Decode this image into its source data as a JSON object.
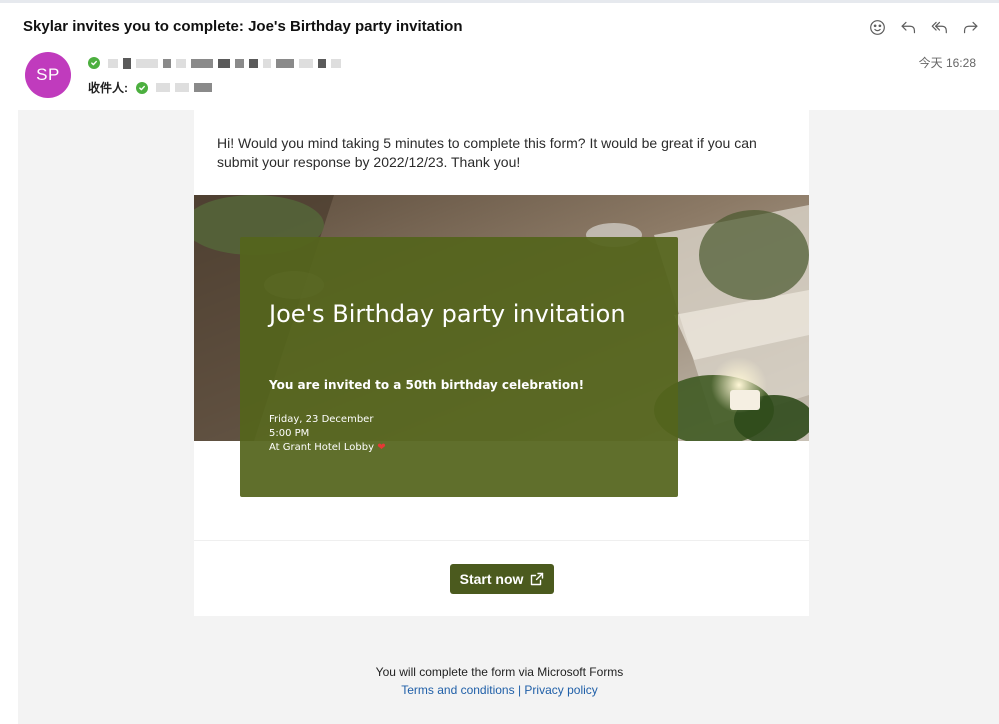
{
  "email": {
    "subject": "Skylar invites you to complete: Joe's Birthday party invitation",
    "avatar_initials": "SP",
    "recipient_label": "收件人:",
    "timestamp": "今天 16:28",
    "toolbar": [
      "emoji-icon",
      "reply-icon",
      "reply-all-icon",
      "forward-icon"
    ]
  },
  "body": {
    "intro": "Hi! Would you mind taking 5 minutes to complete this form? It would be great if you can submit your response by 2022/12/23. Thank you!",
    "invite_title": "Joe's Birthday party invitation",
    "invite_subtitle": "You are invited to a 50th birthday celebration!",
    "date": "Friday, 23 December",
    "time": "5:00 PM",
    "location": "At Grant Hotel Lobby",
    "start_button": "Start now"
  },
  "footer": {
    "note": "You will complete the form via Microsoft Forms",
    "terms": "Terms and conditions",
    "separator": "|",
    "privacy": "Privacy policy"
  },
  "colors": {
    "avatar": "#c03bbd",
    "accent_green": "#4b5a1e",
    "status_green": "#4caf3f",
    "link": "#1f5fa8"
  }
}
